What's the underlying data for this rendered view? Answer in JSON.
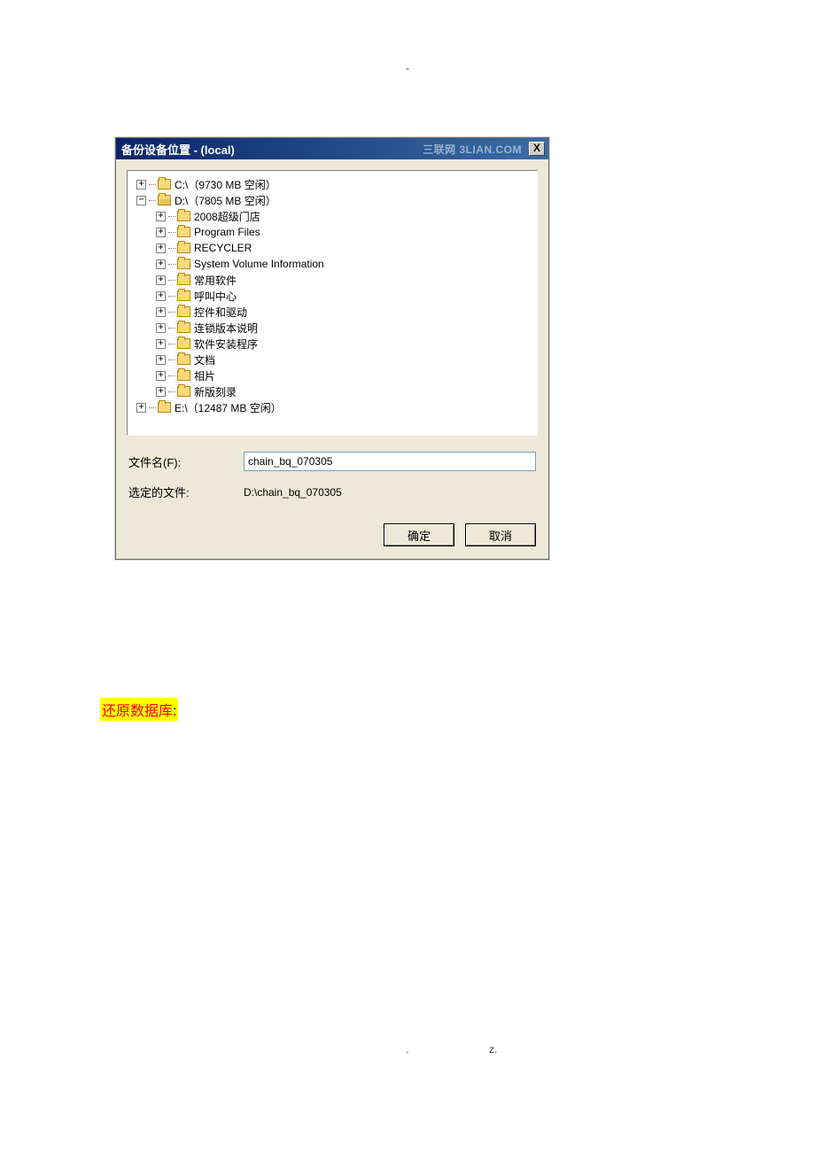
{
  "header_dash": "-",
  "dialog": {
    "title": "备份设备位置 - (local)",
    "watermark": "三联网 3LIAN.COM",
    "close": "X"
  },
  "tree": {
    "drives": [
      {
        "label": "C:\\（9730 MB 空闲）",
        "expanded": false
      },
      {
        "label": "D:\\（7805 MB 空闲）",
        "expanded": true,
        "children": [
          {
            "label": "2008超级门店"
          },
          {
            "label": "Program Files"
          },
          {
            "label": "RECYCLER"
          },
          {
            "label": "System Volume Information"
          },
          {
            "label": "常用软件"
          },
          {
            "label": "呼叫中心"
          },
          {
            "label": "控件和驱动"
          },
          {
            "label": "连锁版本说明"
          },
          {
            "label": "软件安装程序"
          },
          {
            "label": "文档"
          },
          {
            "label": "相片"
          },
          {
            "label": "新版刻录"
          }
        ]
      },
      {
        "label": "E:\\（12487 MB 空闲）",
        "expanded": false
      }
    ]
  },
  "form": {
    "filename_label": "文件名(F):",
    "filename_value": "chain_bq_070305",
    "selected_label": "选定的文件:",
    "selected_value": "D:\\chain_bq_070305"
  },
  "buttons": {
    "ok": "确定",
    "cancel": "取消"
  },
  "annotation": {
    "text": "还原数据库",
    "colon": ":"
  },
  "footer": {
    "dot": ".",
    "z": "z."
  }
}
